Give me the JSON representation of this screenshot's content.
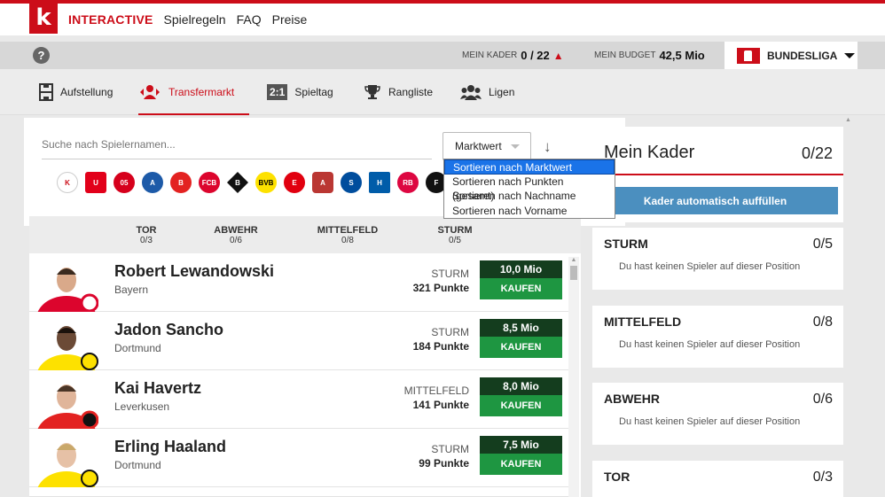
{
  "topnav": {
    "brand": "INTERACTIVE",
    "links": [
      "Spielregeln",
      "FAQ",
      "Preise"
    ],
    "logo_letter": "k"
  },
  "status": {
    "help": "?",
    "kader_label": "MEIN KADER",
    "kader_value": "0 / 22",
    "budget_label": "MEIN BUDGET",
    "budget_value": "42,5 Mio",
    "league": "BUNDESLIGA"
  },
  "tabs": [
    {
      "label": "Aufstellung",
      "icon": "lineup-icon"
    },
    {
      "label": "Transfermarkt",
      "icon": "transfer-icon",
      "active": true
    },
    {
      "label": "Spieltag",
      "icon": "score-icon",
      "badge": "2:1"
    },
    {
      "label": "Rangliste",
      "icon": "trophy-icon"
    },
    {
      "label": "Ligen",
      "icon": "group-icon"
    }
  ],
  "search": {
    "placeholder": "Suche nach Spielernamen...",
    "sort_value": "Marktwert",
    "sort_options": [
      "Sortieren nach Marktwert",
      "Sortieren nach Punkten (gesamt)",
      "Sortieren nach Nachname",
      "Sortieren nach Vorname"
    ]
  },
  "positions": [
    {
      "label": "TOR",
      "count": "0/3"
    },
    {
      "label": "ABWEHR",
      "count": "0/6"
    },
    {
      "label": "MITTELFELD",
      "count": "0/8"
    },
    {
      "label": "STURM",
      "count": "0/5"
    }
  ],
  "players": [
    {
      "name": "Robert Lewandowski",
      "club": "Bayern",
      "position": "STURM",
      "points": "321 Punkte",
      "price": "10,0 Mio",
      "buy": "KAUFEN"
    },
    {
      "name": "Jadon Sancho",
      "club": "Dortmund",
      "position": "STURM",
      "points": "184 Punkte",
      "price": "8,5 Mio",
      "buy": "KAUFEN"
    },
    {
      "name": "Kai Havertz",
      "club": "Leverkusen",
      "position": "MITTELFELD",
      "points": "141 Punkte",
      "price": "8,0 Mio",
      "buy": "KAUFEN"
    },
    {
      "name": "Erling Haaland",
      "club": "Dortmund",
      "position": "STURM",
      "points": "99 Punkte",
      "price": "7,5 Mio",
      "buy": "KAUFEN"
    }
  ],
  "kader": {
    "title": "Mein Kader",
    "count": "0/22",
    "autofill": "Kader automatisch auffüllen",
    "slots": [
      {
        "title": "STURM",
        "count": "0/5",
        "text": "Du hast keinen Spieler auf dieser Position"
      },
      {
        "title": "MITTELFELD",
        "count": "0/8",
        "text": "Du hast keinen Spieler auf dieser Position"
      },
      {
        "title": "ABWEHR",
        "count": "0/6",
        "text": "Du hast keinen Spieler auf dieser Position"
      },
      {
        "title": "TOR",
        "count": "0/3",
        "text": ""
      }
    ]
  },
  "colors": {
    "brand_red": "#cc0d19",
    "price_dark": "#143d1e",
    "buy_green": "#1e9641",
    "autofill_blue": "#4b8fbf"
  }
}
